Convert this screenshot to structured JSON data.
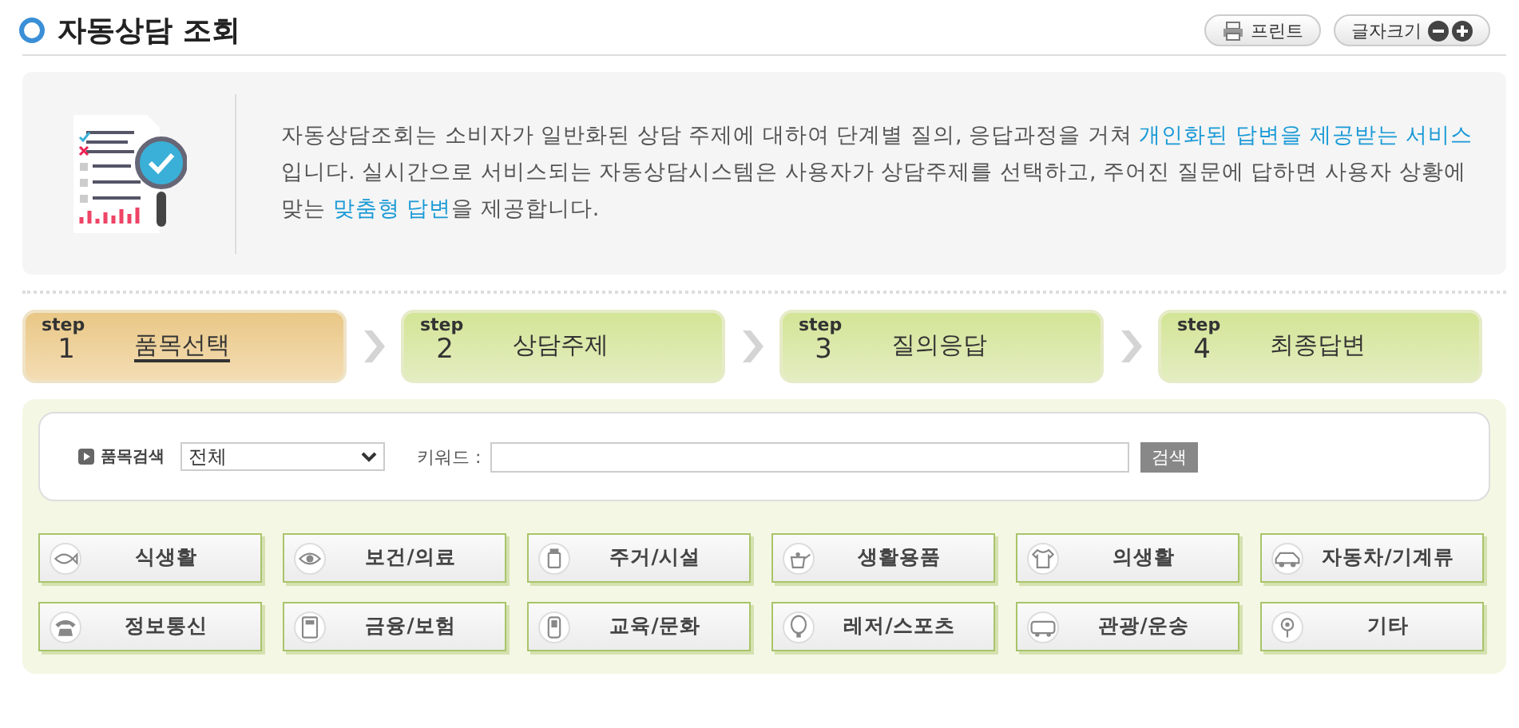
{
  "page_title": "자동상담 조회",
  "toolbar": [
    {
      "label": "프린트",
      "kind": "print"
    },
    {
      "label": "글자크기",
      "kind": "zoom"
    }
  ],
  "intro": {
    "text": "자동상담조회는 소비자가 일반화된 상담 주제에 대하여 단계별 질의, 응답과정을 거쳐 **개인화된 답변을 제공받는 서비스**입니다. 실시간으로 서비스되는 자동상담시스템은 사용자가 상담주제를 선택하고, 주어진 질문에 답하면 사용자 상황에 맞는 **맞춤형 답변**을 제공합니다."
  },
  "steps": [
    {
      "step_label": "step",
      "number": "1",
      "label": "품목선택",
      "selected": true
    },
    {
      "step_label": "step",
      "number": "2",
      "label": "상담주제",
      "selected": false
    },
    {
      "step_label": "step",
      "number": "3",
      "label": "질의응답",
      "selected": false
    },
    {
      "step_label": "step",
      "number": "4",
      "label": "최종답변",
      "selected": false
    }
  ],
  "search": {
    "label": "품목검색",
    "category_value": "전체",
    "keyword_label": "키워드 :",
    "button": "검색"
  },
  "categories": [
    {
      "label": "식생활"
    },
    {
      "label": "보건/의료"
    },
    {
      "label": "주거/시설"
    },
    {
      "label": "생활용품"
    },
    {
      "label": "의생활"
    },
    {
      "label": "자동차/기계류"
    },
    {
      "label": "정보통신"
    },
    {
      "label": "금융/보험"
    },
    {
      "label": "교육/문화"
    },
    {
      "label": "레저/스포츠"
    },
    {
      "label": "관광/운송"
    },
    {
      "label": "기타"
    }
  ]
}
